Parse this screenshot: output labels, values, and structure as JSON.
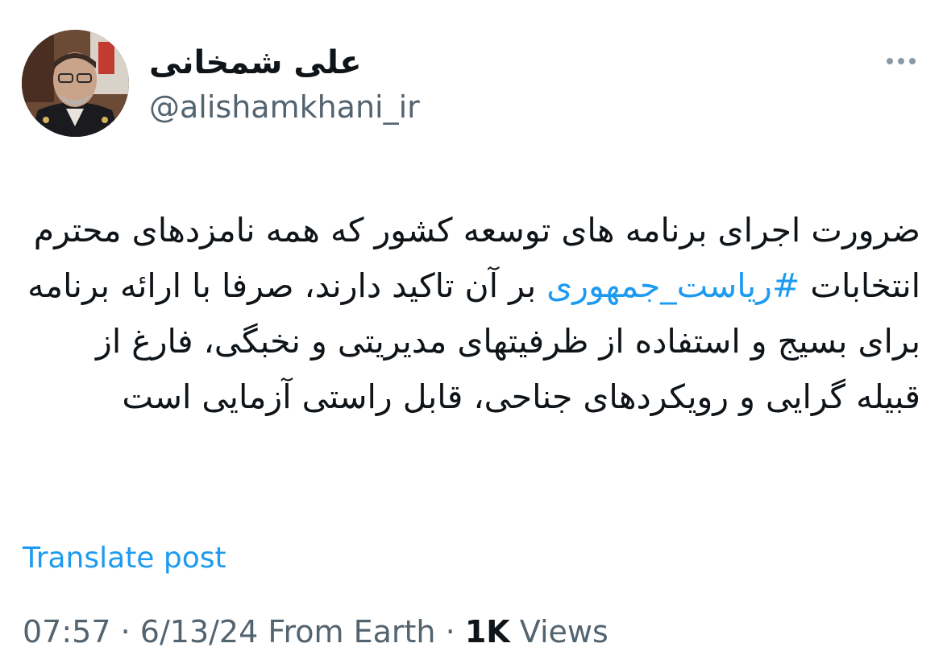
{
  "author": {
    "display_name": "علی شمخانی",
    "handle": "@alishamkhani_ir"
  },
  "more_icon": "more-horizontal-icon",
  "tweet": {
    "text_before_hashtag": "ضرورت اجرای برنامه های توسعه کشور که همه نامزدهای محترم انتخابات ",
    "hashtag": "#ریاست_جمهوری",
    "text_after_hashtag": " بر آن تاکید دارند، صرفا با ارائه برنامه برای بسیج و استفاده از ظرفیتهای مدیریتی و نخبگی، فارغ از قبیله گرایی و رویکردهای جناحی، قابل راستی آزمایی است"
  },
  "translate_label": "Translate post",
  "meta": {
    "time": "07:57",
    "separator": "·",
    "date": "6/13/24",
    "source": "From Earth",
    "views_count": "1K",
    "views_label": "Views"
  },
  "colors": {
    "link": "#1d9bf0",
    "secondary_text": "#536471",
    "primary_text": "#0f1419"
  }
}
